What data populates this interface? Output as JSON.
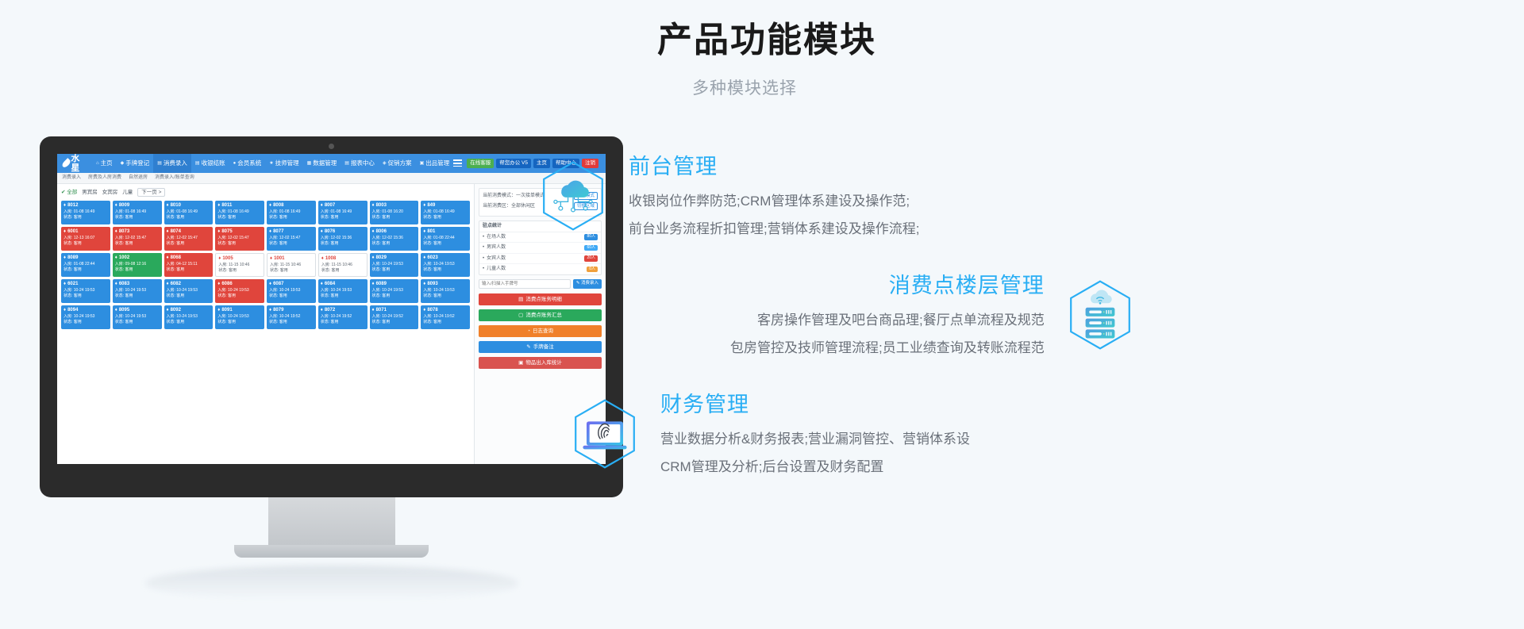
{
  "header": {
    "title": "产品功能模块",
    "subtitle": "多种模块选择"
  },
  "features": [
    {
      "icon": "cloud-network-icon",
      "title": "前台管理",
      "lines": [
        "收银岗位作弊防范;CRM管理体系建设及操作范;",
        "前台业务流程折扣管理;营销体系建设及操作流程;"
      ]
    },
    {
      "icon": "server-stack-cloud-icon",
      "title": "消费点楼层管理",
      "lines": [
        "客房操作管理及吧台商品理;餐厅点单流程及规范",
        "包房管控及技师管理流程;员工业绩查询及转账流程范"
      ]
    },
    {
      "icon": "laptop-fingerprint-icon",
      "title": "财务管理",
      "lines": [
        "营业数据分析&财务报表;营业漏洞管控、营销体系设",
        "CRM管理及分析;后台设置及财务配置"
      ]
    }
  ],
  "app": {
    "logo": "水星",
    "nav": [
      {
        "label": "主页",
        "icon": "home-icon",
        "active": false
      },
      {
        "label": "手牌登记",
        "icon": "tag-icon",
        "active": false
      },
      {
        "label": "消费录入",
        "icon": "cart-icon",
        "active": true
      },
      {
        "label": "收银结账",
        "icon": "cash-icon",
        "active": false
      },
      {
        "label": "会员系统",
        "icon": "user-icon",
        "active": false
      },
      {
        "label": "技师管理",
        "icon": "star-icon",
        "active": false
      },
      {
        "label": "数据管理",
        "icon": "db-icon",
        "active": false
      },
      {
        "label": "报表中心",
        "icon": "chart-icon",
        "active": false
      },
      {
        "label": "促销方案",
        "icon": "gift-icon",
        "active": false
      },
      {
        "label": "出品管理",
        "icon": "box-icon",
        "active": false
      }
    ],
    "topbar_right": [
      {
        "label": "在线客服",
        "color": "green"
      },
      {
        "label": "帮您办公 V5",
        "color": "blue"
      },
      {
        "label": "主页",
        "color": "blue"
      },
      {
        "label": "帮助中心",
        "color": "blue"
      },
      {
        "label": "注销",
        "color": "red"
      }
    ],
    "subbar": [
      "消费录入",
      "房费及人房消费",
      "自然退房",
      "消费录入/账单查询"
    ],
    "filters": {
      "all": "全部",
      "items": [
        "男宾房",
        "女宾房",
        "儿童"
      ],
      "next_page": "下一页 >"
    },
    "rooms": [
      [
        {
          "no": "8012",
          "t1": "入房: 01-08 16:49",
          "t2": "状态: 客用",
          "style": "blue"
        },
        {
          "no": "8009",
          "t1": "入房: 01-08 16:49",
          "t2": "状态: 客用",
          "style": "blue"
        },
        {
          "no": "8010",
          "t1": "入房: 01-08 16:49",
          "t2": "状态: 客用",
          "style": "blue"
        },
        {
          "no": "8011",
          "t1": "入房: 01-08 16:49",
          "t2": "状态: 客用",
          "style": "blue"
        },
        {
          "no": "8008",
          "t1": "入房: 01-08 16:49",
          "t2": "状态: 客用",
          "style": "blue"
        },
        {
          "no": "8007",
          "t1": "入房: 01-08 16:49",
          "t2": "状态: 客用",
          "style": "blue"
        },
        {
          "no": "8003",
          "t1": "入房: 01-08 16:20",
          "t2": "状态: 客用",
          "style": "blue"
        },
        {
          "no": "849",
          "t1": "入房: 01-08 16:49",
          "t2": "状态: 客用",
          "style": "blue"
        },
        {
          "no": "6001",
          "t1": "入房: 12-13 16:07",
          "t2": "状态: 客用",
          "style": "red"
        }
      ],
      [
        {
          "no": "8073",
          "t1": "入房: 12-02 15:47",
          "t2": "状态: 客用",
          "style": "red"
        },
        {
          "no": "8074",
          "t1": "入房: 12-02 15:47",
          "t2": "状态: 客用",
          "style": "red"
        },
        {
          "no": "8075",
          "t1": "入房: 12-02 15:47",
          "t2": "状态: 客用",
          "style": "red"
        },
        {
          "no": "8077",
          "t1": "入房: 12-02 15:47",
          "t2": "状态: 客用",
          "style": "blue"
        },
        {
          "no": "8076",
          "t1": "入房: 12-02 15:36",
          "t2": "状态: 客用",
          "style": "blue"
        },
        {
          "no": "8006",
          "t1": "入房: 12-02 15:36",
          "t2": "状态: 客用",
          "style": "blue"
        },
        {
          "no": "801",
          "t1": "入房: 01-08 22:44",
          "t2": "状态: 客用",
          "style": "blue"
        },
        {
          "no": "8089",
          "t1": "入房: 01-08 22:44",
          "t2": "状态: 客用",
          "style": "blue"
        },
        {
          "no": "1002",
          "t1": "入房: 09-08 12:16",
          "t2": "状态: 客用",
          "style": "green"
        }
      ],
      [
        {
          "no": "8068",
          "t1": "入房: 04-12 15:11",
          "t2": "状态: 客用",
          "style": "red"
        },
        {
          "no": "1005",
          "t1": "入房: 11-15 10:46",
          "t2": "状态: 客用",
          "style": "white"
        },
        {
          "no": "1001",
          "t1": "入房: 11-15 10:46",
          "t2": "状态: 客用",
          "style": "white"
        },
        {
          "no": "1008",
          "t1": "入房: 11-15 10:46",
          "t2": "状态: 客用",
          "style": "white"
        },
        {
          "no": "8029",
          "t1": "入房: 10-24 19:53",
          "t2": "状态: 客用",
          "style": "blue"
        },
        {
          "no": "6023",
          "t1": "入房: 10-24 19:53",
          "t2": "状态: 客用",
          "style": "blue"
        },
        {
          "no": "6021",
          "t1": "入房: 10-24 19:53",
          "t2": "状态: 客用",
          "style": "blue"
        },
        {
          "no": "6083",
          "t1": "入房: 10-24 19:53",
          "t2": "状态: 客用",
          "style": "blue"
        },
        {
          "no": "6082",
          "t1": "入房: 10-24 19:53",
          "t2": "状态: 客用",
          "style": "blue"
        }
      ],
      [
        {
          "no": "6086",
          "t1": "入房: 10-24 19:53",
          "t2": "状态: 客用",
          "style": "red"
        },
        {
          "no": "6087",
          "t1": "入房: 10-24 19:53",
          "t2": "状态: 客用",
          "style": "blue"
        },
        {
          "no": "6084",
          "t1": "入房: 10-24 19:53",
          "t2": "状态: 客用",
          "style": "blue"
        },
        {
          "no": "6089",
          "t1": "入房: 10-24 19:53",
          "t2": "状态: 客用",
          "style": "blue"
        },
        {
          "no": "8093",
          "t1": "入房: 10-24 19:53",
          "t2": "状态: 客用",
          "style": "blue"
        },
        {
          "no": "8094",
          "t1": "入房: 10-24 19:53",
          "t2": "状态: 客用",
          "style": "blue"
        },
        {
          "no": "8095",
          "t1": "入房: 10-24 19:53",
          "t2": "状态: 客用",
          "style": "blue"
        },
        {
          "no": "8092",
          "t1": "入房: 10-24 19:53",
          "t2": "状态: 客用",
          "style": "blue"
        },
        {
          "no": "8091",
          "t1": "入房: 10-24 19:53",
          "t2": "状态: 客用",
          "style": "blue"
        }
      ],
      [
        {
          "no": "8079",
          "t1": "入房: 10-24 19:52",
          "t2": "状态: 客用",
          "style": "blue"
        },
        {
          "no": "8072",
          "t1": "入房: 10-24 19:52",
          "t2": "状态: 客用",
          "style": "blue"
        },
        {
          "no": "8071",
          "t1": "入房: 10-24 19:52",
          "t2": "状态: 客用",
          "style": "blue"
        },
        {
          "no": "8078",
          "t1": "入房: 10-24 19:52",
          "t2": "状态: 客用",
          "style": "blue"
        }
      ]
    ],
    "right": {
      "mode_label": "当前消费模式：一次接单模式",
      "mode_btn": "切换模式",
      "area_label": "当前消费区：全部休闲区",
      "area_btn": "切换区域",
      "stat_title": "驻点统计",
      "stats": [
        {
          "label": "在场人数",
          "value": "80人",
          "badge": "b1"
        },
        {
          "label": "男宾人数",
          "value": "60人",
          "badge": "b2"
        },
        {
          "label": "女宾人数",
          "value": "20人",
          "badge": "b3"
        },
        {
          "label": "儿童人数",
          "value": "0人",
          "badge": "b4"
        }
      ],
      "search_placeholder": "输入/扫描入手牌号",
      "search_btn": "消费录入",
      "actions": [
        {
          "label": "消费点账务明细",
          "icon": "list-icon",
          "style": "red"
        },
        {
          "label": "消费点账务汇总",
          "icon": "doc-icon",
          "style": "green"
        },
        {
          "label": "日志查询",
          "icon": "clock-icon",
          "style": "orange"
        },
        {
          "label": "手牌备注",
          "icon": "note-icon",
          "style": "blue"
        },
        {
          "label": "物品出入库统计",
          "icon": "box-icon",
          "style": "dark"
        }
      ]
    }
  }
}
